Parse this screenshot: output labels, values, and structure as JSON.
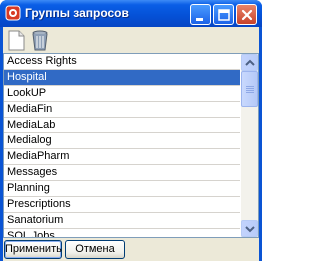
{
  "window": {
    "title": "Группы запросов",
    "controls": {
      "minimize": "minimize-icon",
      "maximize": "maximize-icon",
      "close": "close-icon"
    }
  },
  "toolbar": {
    "new": "new-document-icon",
    "delete": "trash-icon"
  },
  "list": {
    "items": [
      {
        "label": "Access Rights",
        "selected": false
      },
      {
        "label": "Hospital",
        "selected": true
      },
      {
        "label": "LookUP",
        "selected": false
      },
      {
        "label": "MediaFin",
        "selected": false
      },
      {
        "label": "MediaLab",
        "selected": false
      },
      {
        "label": "Medialog",
        "selected": false
      },
      {
        "label": "MediaPharm",
        "selected": false
      },
      {
        "label": "Messages",
        "selected": false
      },
      {
        "label": "Planning",
        "selected": false
      },
      {
        "label": "Prescriptions",
        "selected": false
      },
      {
        "label": "Sanatorium",
        "selected": false
      },
      {
        "label": "SQL Jobs",
        "selected": false
      }
    ]
  },
  "buttons": {
    "apply": "Применить",
    "cancel": "Отмена"
  },
  "colors": {
    "selection": "#316ac5",
    "titlebar": "#0552d8",
    "face": "#ece9d8"
  }
}
